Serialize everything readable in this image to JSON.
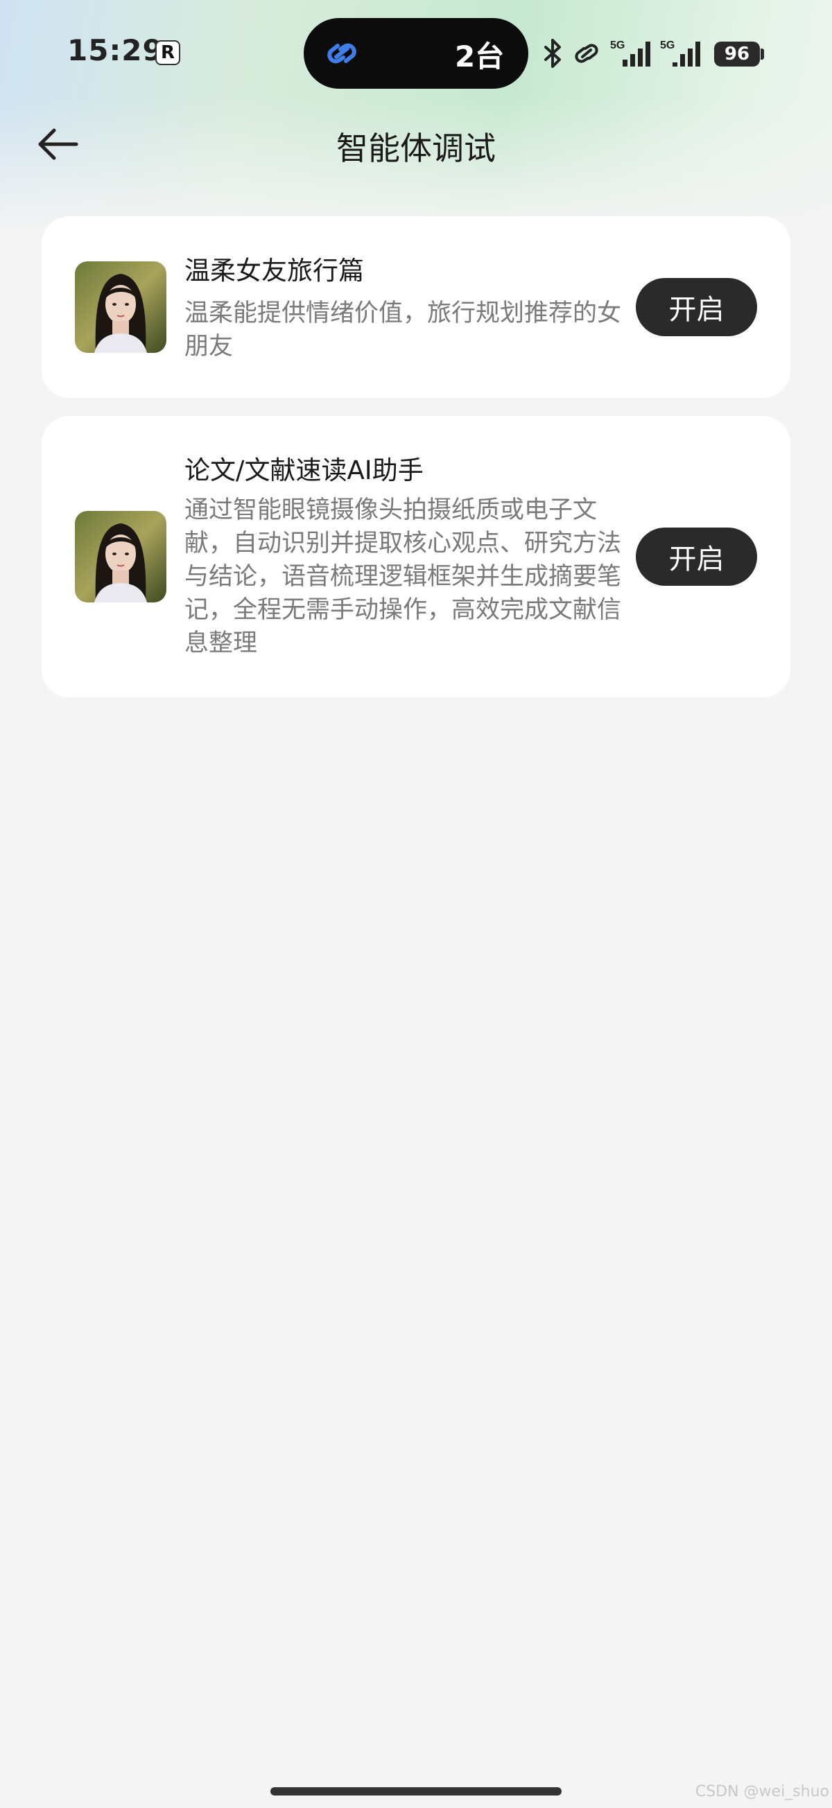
{
  "status_bar": {
    "time": "15:29",
    "app_badge": "R",
    "island_count": "2台",
    "signal_1_label": "5G",
    "signal_2_label": "5G",
    "battery": "96"
  },
  "header": {
    "title": "智能体调试"
  },
  "agents": [
    {
      "title": "温柔女友旅行篇",
      "description": "温柔能提供情绪价值，旅行规划推荐的女朋友",
      "button_label": "开启"
    },
    {
      "title": "论文/文献速读AI助手",
      "description": "通过智能眼镜摄像头拍摄纸质或电子文献，自动识别并提取核心观点、研究方法与结论，语音梳理逻辑框架并生成摘要笔记，全程无需手动操作，高效完成文献信息整理",
      "button_label": "开启"
    }
  ],
  "watermark": "CSDN @wei_shuo",
  "colors": {
    "button_bg": "#2a2a2a",
    "page_bg": "#f4f4f4",
    "card_bg": "#ffffff",
    "island_link": "#3f7de8"
  }
}
